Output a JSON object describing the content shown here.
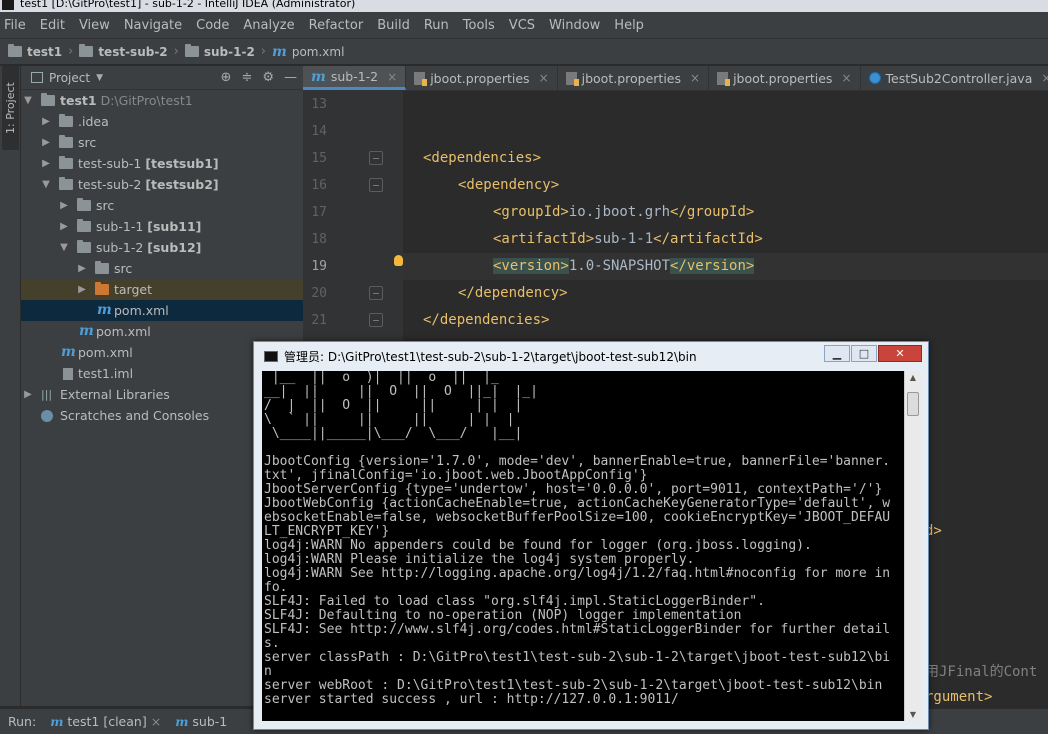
{
  "window": {
    "title": "test1 [D:\\GitPro\\test1] - sub-1-2 - IntelliJ IDEA (Administrator)"
  },
  "menu": [
    "File",
    "Edit",
    "View",
    "Navigate",
    "Code",
    "Analyze",
    "Refactor",
    "Build",
    "Run",
    "Tools",
    "VCS",
    "Window",
    "Help"
  ],
  "breadcrumb": {
    "b1": "test1",
    "b2": "test-sub-2",
    "b3": "sub-1-2",
    "b4": "pom.xml"
  },
  "left_strip": {
    "label": "1: Project"
  },
  "project": {
    "header": "Project",
    "tree": {
      "root": "test1",
      "root_path": "D:\\GitPro\\test1",
      "idea": ".idea",
      "src1": "src",
      "sub1_name": "test-sub-1",
      "sub1_mod": "[testsub1]",
      "sub2_name": "test-sub-2",
      "sub2_mod": "[testsub2]",
      "src2": "src",
      "sub11_name": "sub-1-1",
      "sub11_mod": "[sub11]",
      "sub12_name": "sub-1-2",
      "sub12_mod": "[sub12]",
      "src3": "src",
      "target": "target",
      "pom_sel": "pom.xml",
      "pom2": "pom.xml",
      "pom1": "pom.xml",
      "iml": "test1.iml",
      "libs": "External Libraries",
      "scratches": "Scratches and Consoles"
    }
  },
  "editor": {
    "tabs": [
      "sub-1-2",
      "jboot.properties",
      "jboot.properties",
      "jboot.properties",
      "TestSub2Controller.java"
    ],
    "lines": [
      "13",
      "14",
      "15",
      "16",
      "17",
      "18",
      "19",
      "20",
      "21"
    ],
    "code": {
      "dep_open": "<dependencies>",
      "dependency_open": "<dependency>",
      "g_open": "<groupId>",
      "g_val": "io.jboot.grh",
      "g_close": "</groupId>",
      "a_open": "<artifactId>",
      "a_val": "sub-1-1",
      "a_close": "</artifactId>",
      "v_open": "<version>",
      "v_val": "1.0-SNAPSHOT",
      "v_close": "</version>",
      "dependency_close": "</dependency>",
      "dep_close": "</dependencies>",
      "peek1": "d>",
      "peek2": "用JFinal的Cont",
      "peek3": "rgument>"
    }
  },
  "console": {
    "title": "管理员: D:\\GitPro\\test1\\test-sub-2\\sub-1-2\\target\\jboot-test-sub12\\bin",
    "lines": [
      " |__  ||  o  )|  ||  o  ||  |_",
      "__|  ||     ||  O  ||  O  ||_|  |_|",
      "/  |  ||  O  ||     ||     | |  |",
      "\\  ` ||     ||     ||     | |  |",
      " \\____||_____|\\___/  \\___/   |__|",
      "",
      "JbootConfig {version='1.7.0', mode='dev', bannerEnable=true, bannerFile='banner.",
      "txt', jfinalConfig='io.jboot.web.JbootAppConfig'}",
      "JbootServerConfig {type='undertow', host='0.0.0.0', port=9011, contextPath='/'}",
      "JbootWebConfig {actionCacheEnable=true, actionCacheKeyGeneratorType='default', w",
      "ebsocketEnable=false, websocketBufferPoolSize=100, cookieEncryptKey='JBOOT_DEFAU",
      "LT_ENCRYPT_KEY'}",
      "log4j:WARN No appenders could be found for logger (org.jboss.logging).",
      "log4j:WARN Please initialize the log4j system properly.",
      "log4j:WARN See http://logging.apache.org/log4j/1.2/faq.html#noconfig for more in",
      "fo.",
      "SLF4J: Failed to load class \"org.slf4j.impl.StaticLoggerBinder\".",
      "SLF4J: Defaulting to no-operation (NOP) logger implementation",
      "SLF4J: See http://www.slf4j.org/codes.html#StaticLoggerBinder for further detail",
      "s.",
      "server classPath : D:\\GitPro\\test1\\test-sub-2\\sub-1-2\\target\\jboot-test-sub12\\bi",
      "n",
      "server webRoot : D:\\GitPro\\test1\\test-sub-2\\sub-1-2\\target\\jboot-test-sub12\\bin",
      "server started success , url : http://127.0.0.1:9011/"
    ]
  },
  "run": {
    "label": "Run:",
    "tab1": "test1 [clean]",
    "tab2": "sub-1"
  }
}
